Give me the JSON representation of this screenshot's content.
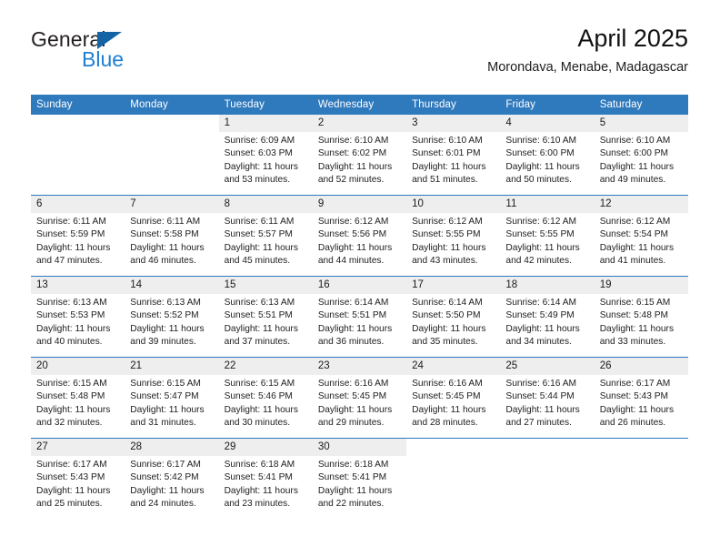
{
  "brand": {
    "name_top": "General",
    "name_bottom": "Blue",
    "accent_color": "#1464a5",
    "text_color": "#231f20"
  },
  "header": {
    "title": "April 2025",
    "location": "Morondava, Menabe, Madagascar"
  },
  "theme": {
    "header_bar_color": "#2f79bd",
    "daynum_band_color": "#eeeeee",
    "rule_color": "#2f79bd"
  },
  "weekday_headers": [
    "Sunday",
    "Monday",
    "Tuesday",
    "Wednesday",
    "Thursday",
    "Friday",
    "Saturday"
  ],
  "weeks": [
    [
      {
        "day": "",
        "blank": true
      },
      {
        "day": "",
        "blank": true
      },
      {
        "day": "1",
        "sunrise": "Sunrise: 6:09 AM",
        "sunset": "Sunset: 6:03 PM",
        "daylight_line1": "Daylight: 11 hours",
        "daylight_line2": "and 53 minutes."
      },
      {
        "day": "2",
        "sunrise": "Sunrise: 6:10 AM",
        "sunset": "Sunset: 6:02 PM",
        "daylight_line1": "Daylight: 11 hours",
        "daylight_line2": "and 52 minutes."
      },
      {
        "day": "3",
        "sunrise": "Sunrise: 6:10 AM",
        "sunset": "Sunset: 6:01 PM",
        "daylight_line1": "Daylight: 11 hours",
        "daylight_line2": "and 51 minutes."
      },
      {
        "day": "4",
        "sunrise": "Sunrise: 6:10 AM",
        "sunset": "Sunset: 6:00 PM",
        "daylight_line1": "Daylight: 11 hours",
        "daylight_line2": "and 50 minutes."
      },
      {
        "day": "5",
        "sunrise": "Sunrise: 6:10 AM",
        "sunset": "Sunset: 6:00 PM",
        "daylight_line1": "Daylight: 11 hours",
        "daylight_line2": "and 49 minutes."
      }
    ],
    [
      {
        "day": "6",
        "sunrise": "Sunrise: 6:11 AM",
        "sunset": "Sunset: 5:59 PM",
        "daylight_line1": "Daylight: 11 hours",
        "daylight_line2": "and 47 minutes."
      },
      {
        "day": "7",
        "sunrise": "Sunrise: 6:11 AM",
        "sunset": "Sunset: 5:58 PM",
        "daylight_line1": "Daylight: 11 hours",
        "daylight_line2": "and 46 minutes."
      },
      {
        "day": "8",
        "sunrise": "Sunrise: 6:11 AM",
        "sunset": "Sunset: 5:57 PM",
        "daylight_line1": "Daylight: 11 hours",
        "daylight_line2": "and 45 minutes."
      },
      {
        "day": "9",
        "sunrise": "Sunrise: 6:12 AM",
        "sunset": "Sunset: 5:56 PM",
        "daylight_line1": "Daylight: 11 hours",
        "daylight_line2": "and 44 minutes."
      },
      {
        "day": "10",
        "sunrise": "Sunrise: 6:12 AM",
        "sunset": "Sunset: 5:55 PM",
        "daylight_line1": "Daylight: 11 hours",
        "daylight_line2": "and 43 minutes."
      },
      {
        "day": "11",
        "sunrise": "Sunrise: 6:12 AM",
        "sunset": "Sunset: 5:55 PM",
        "daylight_line1": "Daylight: 11 hours",
        "daylight_line2": "and 42 minutes."
      },
      {
        "day": "12",
        "sunrise": "Sunrise: 6:12 AM",
        "sunset": "Sunset: 5:54 PM",
        "daylight_line1": "Daylight: 11 hours",
        "daylight_line2": "and 41 minutes."
      }
    ],
    [
      {
        "day": "13",
        "sunrise": "Sunrise: 6:13 AM",
        "sunset": "Sunset: 5:53 PM",
        "daylight_line1": "Daylight: 11 hours",
        "daylight_line2": "and 40 minutes."
      },
      {
        "day": "14",
        "sunrise": "Sunrise: 6:13 AM",
        "sunset": "Sunset: 5:52 PM",
        "daylight_line1": "Daylight: 11 hours",
        "daylight_line2": "and 39 minutes."
      },
      {
        "day": "15",
        "sunrise": "Sunrise: 6:13 AM",
        "sunset": "Sunset: 5:51 PM",
        "daylight_line1": "Daylight: 11 hours",
        "daylight_line2": "and 37 minutes."
      },
      {
        "day": "16",
        "sunrise": "Sunrise: 6:14 AM",
        "sunset": "Sunset: 5:51 PM",
        "daylight_line1": "Daylight: 11 hours",
        "daylight_line2": "and 36 minutes."
      },
      {
        "day": "17",
        "sunrise": "Sunrise: 6:14 AM",
        "sunset": "Sunset: 5:50 PM",
        "daylight_line1": "Daylight: 11 hours",
        "daylight_line2": "and 35 minutes."
      },
      {
        "day": "18",
        "sunrise": "Sunrise: 6:14 AM",
        "sunset": "Sunset: 5:49 PM",
        "daylight_line1": "Daylight: 11 hours",
        "daylight_line2": "and 34 minutes."
      },
      {
        "day": "19",
        "sunrise": "Sunrise: 6:15 AM",
        "sunset": "Sunset: 5:48 PM",
        "daylight_line1": "Daylight: 11 hours",
        "daylight_line2": "and 33 minutes."
      }
    ],
    [
      {
        "day": "20",
        "sunrise": "Sunrise: 6:15 AM",
        "sunset": "Sunset: 5:48 PM",
        "daylight_line1": "Daylight: 11 hours",
        "daylight_line2": "and 32 minutes."
      },
      {
        "day": "21",
        "sunrise": "Sunrise: 6:15 AM",
        "sunset": "Sunset: 5:47 PM",
        "daylight_line1": "Daylight: 11 hours",
        "daylight_line2": "and 31 minutes."
      },
      {
        "day": "22",
        "sunrise": "Sunrise: 6:15 AM",
        "sunset": "Sunset: 5:46 PM",
        "daylight_line1": "Daylight: 11 hours",
        "daylight_line2": "and 30 minutes."
      },
      {
        "day": "23",
        "sunrise": "Sunrise: 6:16 AM",
        "sunset": "Sunset: 5:45 PM",
        "daylight_line1": "Daylight: 11 hours",
        "daylight_line2": "and 29 minutes."
      },
      {
        "day": "24",
        "sunrise": "Sunrise: 6:16 AM",
        "sunset": "Sunset: 5:45 PM",
        "daylight_line1": "Daylight: 11 hours",
        "daylight_line2": "and 28 minutes."
      },
      {
        "day": "25",
        "sunrise": "Sunrise: 6:16 AM",
        "sunset": "Sunset: 5:44 PM",
        "daylight_line1": "Daylight: 11 hours",
        "daylight_line2": "and 27 minutes."
      },
      {
        "day": "26",
        "sunrise": "Sunrise: 6:17 AM",
        "sunset": "Sunset: 5:43 PM",
        "daylight_line1": "Daylight: 11 hours",
        "daylight_line2": "and 26 minutes."
      }
    ],
    [
      {
        "day": "27",
        "sunrise": "Sunrise: 6:17 AM",
        "sunset": "Sunset: 5:43 PM",
        "daylight_line1": "Daylight: 11 hours",
        "daylight_line2": "and 25 minutes."
      },
      {
        "day": "28",
        "sunrise": "Sunrise: 6:17 AM",
        "sunset": "Sunset: 5:42 PM",
        "daylight_line1": "Daylight: 11 hours",
        "daylight_line2": "and 24 minutes."
      },
      {
        "day": "29",
        "sunrise": "Sunrise: 6:18 AM",
        "sunset": "Sunset: 5:41 PM",
        "daylight_line1": "Daylight: 11 hours",
        "daylight_line2": "and 23 minutes."
      },
      {
        "day": "30",
        "sunrise": "Sunrise: 6:18 AM",
        "sunset": "Sunset: 5:41 PM",
        "daylight_line1": "Daylight: 11 hours",
        "daylight_line2": "and 22 minutes."
      },
      {
        "day": "",
        "blank": true
      },
      {
        "day": "",
        "blank": true
      },
      {
        "day": "",
        "blank": true
      }
    ]
  ]
}
